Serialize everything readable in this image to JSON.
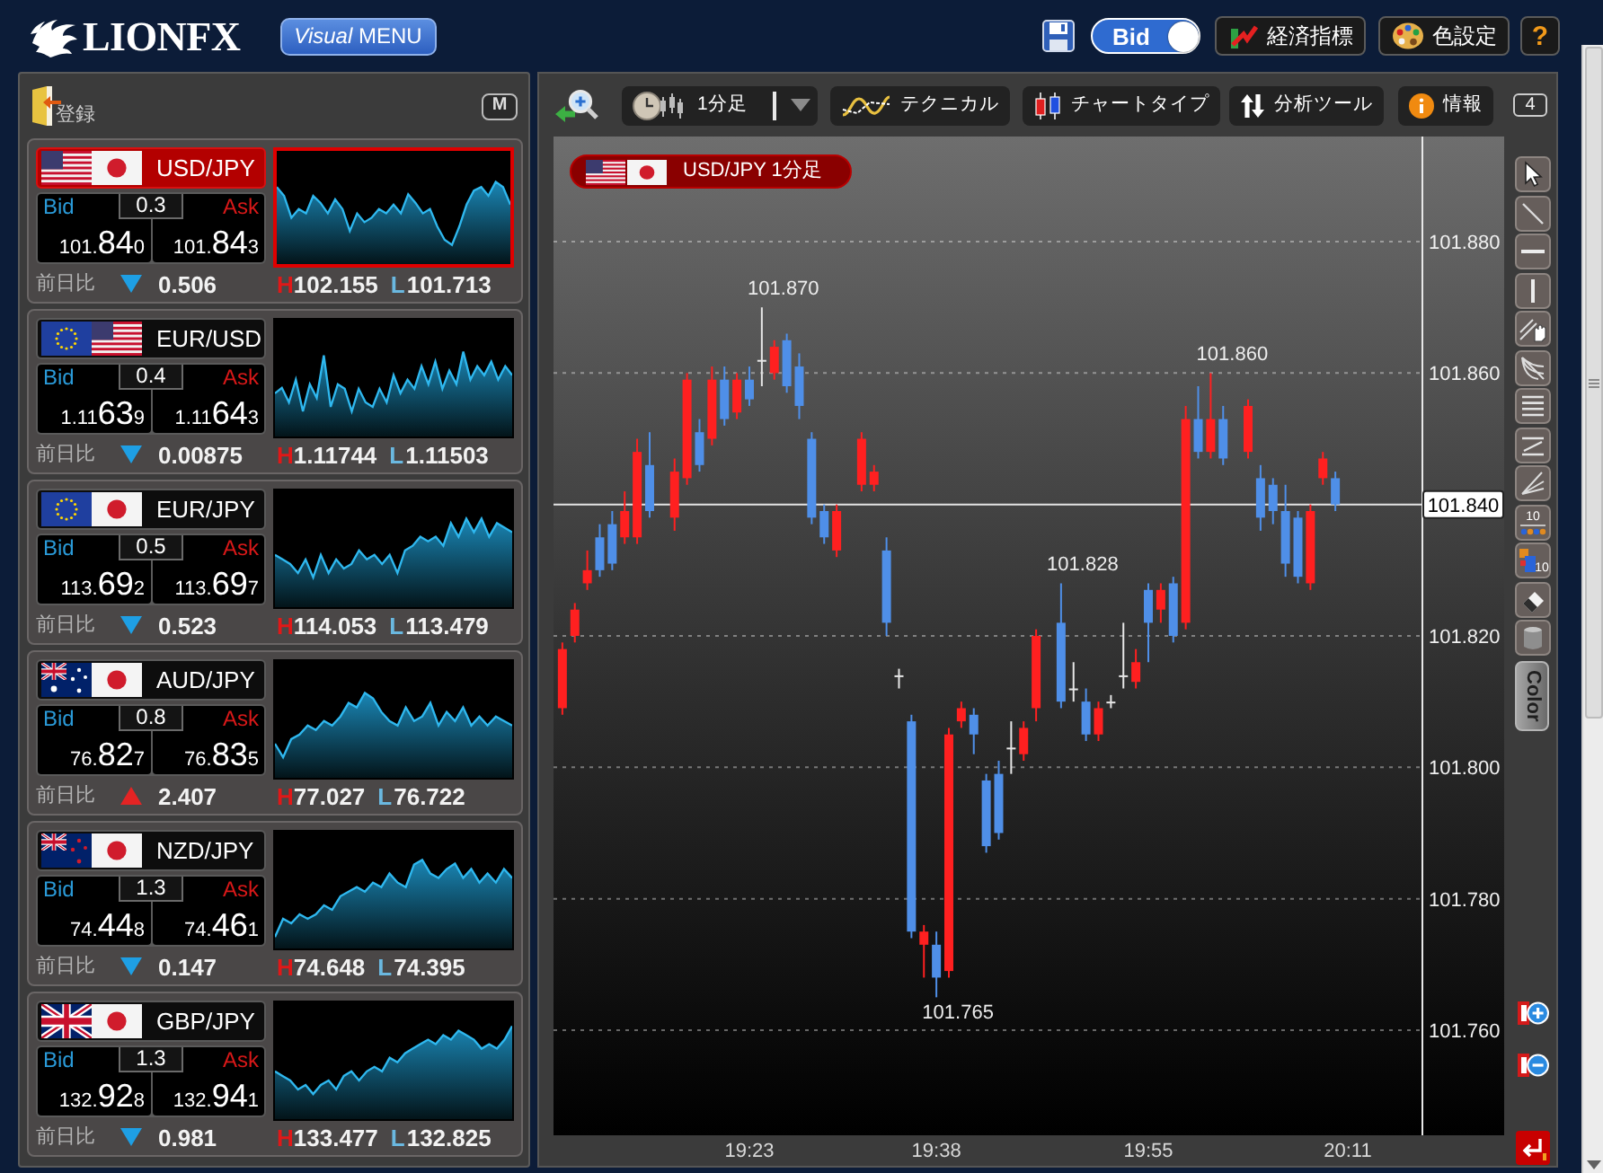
{
  "header": {
    "logo": "LIONFX",
    "menu_button": "*Visual* MENU",
    "price_toggle": {
      "label": "Bid",
      "on": true
    },
    "buttons": [
      {
        "kind": "indicators",
        "label": "経済指標"
      },
      {
        "kind": "colors",
        "label": "色設定"
      },
      {
        "kind": "help",
        "label": "?"
      }
    ]
  },
  "rate_panel": {
    "register_label": "登録",
    "mode_button": "M",
    "pairs": [
      {
        "pair": "USD/JPY",
        "flags": [
          {
            "kind": "us"
          },
          {
            "kind": "jp"
          }
        ],
        "selected": true,
        "bid_label": "Bid",
        "spread": "0.3",
        "ask_label": "Ask",
        "bid": {
          "head": "101.",
          "pips": "84",
          "tail": "0"
        },
        "ask": {
          "head": "101.",
          "pips": "84",
          "tail": "3"
        },
        "change_label": "前日比",
        "rising": false,
        "change": "0.506",
        "high": {
          "label": "H",
          "value": "102.155"
        },
        "low": {
          "label": "L",
          "value": "101.713"
        }
      },
      {
        "pair": "EUR/USD",
        "flags": [
          {
            "kind": "eu"
          },
          {
            "kind": "us"
          }
        ],
        "selected": false,
        "bid_label": "Bid",
        "spread": "0.4",
        "ask_label": "Ask",
        "bid": {
          "head": "1.11",
          "pips": "63",
          "tail": "9"
        },
        "ask": {
          "head": "1.11",
          "pips": "64",
          "tail": "3"
        },
        "change_label": "前日比",
        "rising": false,
        "change": "0.00875",
        "high": {
          "label": "H",
          "value": "1.11744"
        },
        "low": {
          "label": "L",
          "value": "1.11503"
        }
      },
      {
        "pair": "EUR/JPY",
        "flags": [
          {
            "kind": "eu"
          },
          {
            "kind": "jp"
          }
        ],
        "selected": false,
        "bid_label": "Bid",
        "spread": "0.5",
        "ask_label": "Ask",
        "bid": {
          "head": "113.",
          "pips": "69",
          "tail": "2"
        },
        "ask": {
          "head": "113.",
          "pips": "69",
          "tail": "7"
        },
        "change_label": "前日比",
        "rising": false,
        "change": "0.523",
        "high": {
          "label": "H",
          "value": "114.053"
        },
        "low": {
          "label": "L",
          "value": "113.479"
        }
      },
      {
        "pair": "AUD/JPY",
        "flags": [
          {
            "kind": "au"
          },
          {
            "kind": "jp"
          }
        ],
        "selected": false,
        "bid_label": "Bid",
        "spread": "0.8",
        "ask_label": "Ask",
        "bid": {
          "head": "76.",
          "pips": "82",
          "tail": "7"
        },
        "ask": {
          "head": "76.",
          "pips": "83",
          "tail": "5"
        },
        "change_label": "前日比",
        "rising": true,
        "change": "2.407",
        "high": {
          "label": "H",
          "value": "77.027"
        },
        "low": {
          "label": "L",
          "value": "76.722"
        }
      },
      {
        "pair": "NZD/JPY",
        "flags": [
          {
            "kind": "nz"
          },
          {
            "kind": "jp"
          }
        ],
        "selected": false,
        "bid_label": "Bid",
        "spread": "1.3",
        "ask_label": "Ask",
        "bid": {
          "head": "74.",
          "pips": "44",
          "tail": "8"
        },
        "ask": {
          "head": "74.",
          "pips": "46",
          "tail": "1"
        },
        "change_label": "前日比",
        "rising": false,
        "change": "0.147",
        "high": {
          "label": "H",
          "value": "74.648"
        },
        "low": {
          "label": "L",
          "value": "74.395"
        }
      },
      {
        "pair": "GBP/JPY",
        "flags": [
          {
            "kind": "gb"
          },
          {
            "kind": "jp"
          }
        ],
        "selected": false,
        "bid_label": "Bid",
        "spread": "1.3",
        "ask_label": "Ask",
        "bid": {
          "head": "132.",
          "pips": "92",
          "tail": "8"
        },
        "ask": {
          "head": "132.",
          "pips": "94",
          "tail": "1"
        },
        "change_label": "前日比",
        "rising": false,
        "change": "0.981",
        "high": {
          "label": "H",
          "value": "133.477"
        },
        "low": {
          "label": "L",
          "value": "132.825"
        }
      }
    ]
  },
  "chart": {
    "toolbar": {
      "left": [
        {
          "kind": "timeframe",
          "label": "1分足"
        },
        {
          "kind": "technical",
          "label": "テクニカル"
        },
        {
          "kind": "chart-type",
          "label": "チャートタイプ"
        }
      ],
      "right": [
        {
          "kind": "analysis",
          "label": "分析ツール"
        },
        {
          "kind": "info",
          "label": "情報"
        }
      ],
      "count": "4"
    },
    "title_flags": [
      {
        "kind": "us"
      },
      {
        "kind": "jp"
      }
    ],
    "chart_data": {
      "type": "candlestick",
      "title": "USD/JPY 1分足",
      "x": [
        1148,
        1149,
        1150,
        1151,
        1152,
        1153,
        1154,
        1155,
        1157,
        1158,
        1159,
        1160,
        1161,
        1162,
        1163,
        1164,
        1165,
        1166,
        1167,
        1168,
        1169,
        1170,
        1172,
        1173,
        1174,
        1175,
        1176,
        1177,
        1178,
        1179,
        1180,
        1181,
        1182,
        1183,
        1184,
        1185,
        1186,
        1188,
        1189,
        1190,
        1191,
        1192,
        1193,
        1194,
        1195,
        1196,
        1197,
        1198,
        1199,
        1200,
        1201,
        1203,
        1204,
        1205,
        1206,
        1207,
        1208,
        1209,
        1210
      ],
      "ohlc": [
        [
          101.809,
          101.819,
          101.808,
          101.818
        ],
        [
          101.82,
          101.825,
          101.819,
          101.824
        ],
        [
          101.828,
          101.833,
          101.827,
          101.83
        ],
        [
          101.835,
          101.837,
          101.829,
          101.83
        ],
        [
          101.837,
          101.839,
          101.83,
          101.831
        ],
        [
          101.835,
          101.842,
          101.834,
          101.839
        ],
        [
          101.835,
          101.85,
          101.834,
          101.848
        ],
        [
          101.846,
          101.851,
          101.838,
          101.839
        ],
        [
          101.838,
          101.847,
          101.836,
          101.845
        ],
        [
          101.844,
          101.86,
          101.843,
          101.859
        ],
        [
          101.851,
          101.853,
          101.845,
          101.846
        ],
        [
          101.85,
          101.861,
          101.849,
          101.859
        ],
        [
          101.859,
          101.861,
          101.852,
          101.853
        ],
        [
          101.854,
          101.86,
          101.853,
          101.859
        ],
        [
          101.859,
          101.861,
          101.855,
          101.856
        ],
        [
          101.862,
          101.87,
          101.858,
          101.862
        ],
        [
          101.86,
          101.865,
          101.859,
          101.864
        ],
        [
          101.865,
          101.866,
          101.857,
          101.858
        ],
        [
          101.861,
          101.863,
          101.853,
          101.855
        ],
        [
          101.85,
          101.851,
          101.837,
          101.838
        ],
        [
          101.839,
          101.84,
          101.834,
          101.835
        ],
        [
          101.833,
          101.84,
          101.832,
          101.839
        ],
        [
          101.843,
          101.851,
          101.842,
          101.85
        ],
        [
          101.843,
          101.846,
          101.842,
          101.845
        ],
        [
          101.833,
          101.835,
          101.82,
          101.822
        ],
        [
          101.814,
          101.815,
          101.812,
          101.814
        ],
        [
          101.807,
          101.808,
          101.774,
          101.775
        ],
        [
          101.773,
          101.776,
          101.768,
          101.775
        ],
        [
          101.773,
          101.775,
          101.765,
          101.768
        ],
        [
          101.769,
          101.806,
          101.768,
          101.805
        ],
        [
          101.807,
          101.81,
          101.806,
          101.809
        ],
        [
          101.808,
          101.809,
          101.802,
          101.805
        ],
        [
          101.798,
          101.799,
          101.787,
          101.788
        ],
        [
          101.799,
          101.801,
          101.789,
          101.79
        ],
        [
          101.803,
          101.807,
          101.799,
          101.803
        ],
        [
          101.802,
          101.807,
          101.801,
          101.806
        ],
        [
          101.809,
          101.821,
          101.807,
          101.82
        ],
        [
          101.822,
          101.828,
          101.809,
          101.81
        ],
        [
          101.812,
          101.816,
          101.81,
          101.812
        ],
        [
          101.81,
          101.812,
          101.804,
          101.805
        ],
        [
          101.805,
          101.81,
          101.804,
          101.809
        ],
        [
          101.81,
          101.811,
          101.809,
          101.81
        ],
        [
          101.814,
          101.822,
          101.812,
          101.814
        ],
        [
          101.813,
          101.818,
          101.812,
          101.816
        ],
        [
          101.827,
          101.828,
          101.816,
          101.822
        ],
        [
          101.824,
          101.828,
          101.822,
          101.827
        ],
        [
          101.828,
          101.829,
          101.819,
          101.82
        ],
        [
          101.822,
          101.855,
          101.821,
          101.853
        ],
        [
          101.853,
          101.858,
          101.847,
          101.848
        ],
        [
          101.848,
          101.86,
          101.847,
          101.853
        ],
        [
          101.853,
          101.855,
          101.846,
          101.847
        ],
        [
          101.848,
          101.856,
          101.847,
          101.855
        ],
        [
          101.844,
          101.846,
          101.836,
          101.838
        ],
        [
          101.843,
          101.844,
          101.837,
          101.839
        ],
        [
          101.839,
          101.843,
          101.829,
          101.831
        ],
        [
          101.838,
          101.839,
          101.828,
          101.829
        ],
        [
          101.828,
          101.84,
          101.827,
          101.839
        ],
        [
          101.844,
          101.848,
          101.843,
          101.847
        ],
        [
          101.844,
          101.845,
          101.839,
          101.84
        ]
      ],
      "xlim": [
        1147.29,
        1223.54
      ],
      "ylim": [
        101.744,
        101.896
      ],
      "grid": true,
      "xticks": [
        {
          "value": 1163,
          "label": "19:23"
        },
        {
          "value": 1178,
          "label": "19:38"
        },
        {
          "value": 1195,
          "label": "19:55"
        },
        {
          "value": 1211,
          "label": "20:11"
        }
      ],
      "yticks": [
        {
          "value": 101.88,
          "label": "101.880"
        },
        {
          "value": 101.86,
          "label": "101.860"
        },
        {
          "value": 101.82,
          "label": "101.820"
        },
        {
          "value": 101.8,
          "label": "101.800"
        },
        {
          "value": 101.78,
          "label": "101.780"
        },
        {
          "value": 101.76,
          "label": "101.760"
        }
      ],
      "ref_lines": [
        {
          "axis": "y",
          "value": 101.84,
          "label": "101.840"
        }
      ],
      "annotations": [
        {
          "x": 1164,
          "y": 101.87,
          "text": "101.870"
        },
        {
          "x": 1178,
          "y": 101.765,
          "text": "101.765"
        },
        {
          "x": 1188,
          "y": 101.828,
          "text": "101.828"
        },
        {
          "x": 1200,
          "y": 101.86,
          "text": "101.860"
        }
      ]
    },
    "tools": [
      {
        "kind": "pointer"
      },
      {
        "kind": "trend-line"
      },
      {
        "kind": "horizontal-line"
      },
      {
        "kind": "vertical-line"
      },
      {
        "kind": "hand-lines"
      },
      {
        "kind": "arc-fan"
      },
      {
        "kind": "parallel-lines"
      },
      {
        "kind": "channel"
      },
      {
        "kind": "fan-lines"
      },
      {
        "kind": "level-dots",
        "caption": "10"
      },
      {
        "kind": "level-blocks",
        "caption": "10"
      },
      {
        "kind": "eraser"
      },
      {
        "kind": "trash"
      }
    ],
    "color_button": "Color"
  }
}
